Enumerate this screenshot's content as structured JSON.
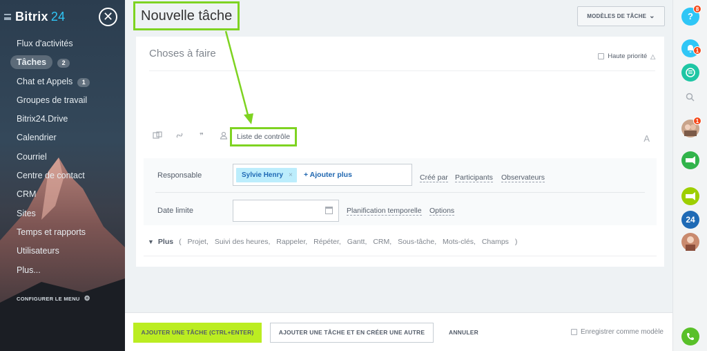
{
  "sidebar": {
    "logo_text": "Bitrix",
    "logo_num": "24",
    "items": [
      {
        "label": "Flux d'activités",
        "badge": ""
      },
      {
        "label": "Tâches",
        "badge": "2"
      },
      {
        "label": "Chat et Appels",
        "badge": "1"
      },
      {
        "label": "Groupes de travail",
        "badge": ""
      },
      {
        "label": "Bitrix24.Drive",
        "badge": ""
      },
      {
        "label": "Calendrier",
        "badge": ""
      },
      {
        "label": "Courriel",
        "badge": ""
      },
      {
        "label": "Centre de contact",
        "badge": ""
      },
      {
        "label": "CRM",
        "badge": ""
      },
      {
        "label": "Sites",
        "badge": ""
      },
      {
        "label": "Temps et rapports",
        "badge": ""
      },
      {
        "label": "Utilisateurs",
        "badge": ""
      },
      {
        "label": "Plus...",
        "badge": ""
      }
    ],
    "config_label": "CONFIGURER LE MENU",
    "close_glyph": "✕"
  },
  "header": {
    "title": "Nouvelle tâche",
    "templates_label": "MODÈLES DE TÂCHE"
  },
  "task": {
    "title_placeholder": "Choses à faire",
    "priority_label": "Haute priorité",
    "checklist_label": "Liste de contrôle",
    "font_glyph": "A"
  },
  "details": {
    "responsible_label": "Responsable",
    "responsible_person": "Sylvie Henry",
    "chip_remove": "×",
    "add_more": "+ Ajouter plus",
    "created_by": "Créé par",
    "participants": "Participants",
    "observers": "Observateurs",
    "deadline_label": "Date limite",
    "planning": "Planification temporelle",
    "options": "Options"
  },
  "plus": {
    "label": "Plus",
    "open_paren": "(",
    "close_paren": ")",
    "items": [
      "Projet,",
      "Suivi des heures,",
      "Rappeler,",
      "Répéter,",
      "Gantt,",
      "CRM,",
      "Sous-tâche,",
      "Mots-clés,",
      "Champs"
    ]
  },
  "footer": {
    "add_task": "AJOUTER UNE TÂCHE (CTRL+ENTER)",
    "add_and_new": "AJOUTER UNE TÂCHE ET EN CRÉER UNE AUTRE",
    "cancel": "ANNULER",
    "save_template": "Enregistrer comme modèle"
  },
  "rightbar": {
    "help_glyph": "?",
    "help_badge": "8",
    "notif_badge": "1",
    "contacts_badge": "1",
    "b24_label": "24"
  },
  "colors": {
    "accent_green": "#7ed321",
    "primary_button": "#bbed21",
    "chip_bg": "#bcedfc",
    "link_blue": "#2067b0",
    "sidebar_bg": "#2b3d4f"
  }
}
